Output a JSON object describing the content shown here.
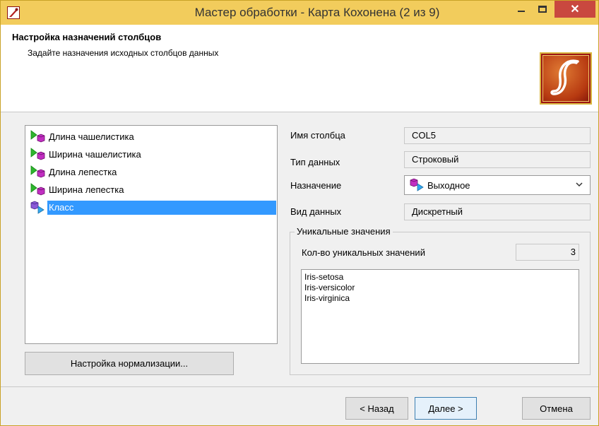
{
  "window": {
    "title": "Мастер обработки - Карта Кохонена (2 из 9)",
    "close_label": "✕"
  },
  "header": {
    "title": "Настройка назначений столбцов",
    "subtitle": "Задайте назначения исходных столбцов данных"
  },
  "columns": [
    {
      "label": "Длина чашелистика",
      "role": "input"
    },
    {
      "label": "Ширина чашелистика",
      "role": "input"
    },
    {
      "label": "Длина лепестка",
      "role": "input"
    },
    {
      "label": "Ширина лепестка",
      "role": "input"
    },
    {
      "label": "Класс",
      "role": "output",
      "selected": true
    }
  ],
  "normalization_button": "Настройка нормализации...",
  "form": {
    "name_label": "Имя столбца",
    "name_value": "COL5",
    "type_label": "Тип данных",
    "type_value": "Строковый",
    "purpose_label": "Назначение",
    "purpose_value": "Выходное",
    "kind_label": "Вид данных",
    "kind_value": "Дискретный"
  },
  "unique": {
    "legend": "Уникальные значения",
    "count_label": "Кол-во уникальных значений",
    "count_value": "3",
    "values": [
      "Iris-setosa",
      "Iris-versicolor",
      "Iris-virginica"
    ]
  },
  "footer": {
    "back": "< Назад",
    "next": "Далее >",
    "cancel": "Отмена"
  },
  "colors": {
    "titlebar": "#f2cc5c",
    "selection": "#3399ff",
    "close": "#c9483f",
    "logo": "#9b1515"
  }
}
